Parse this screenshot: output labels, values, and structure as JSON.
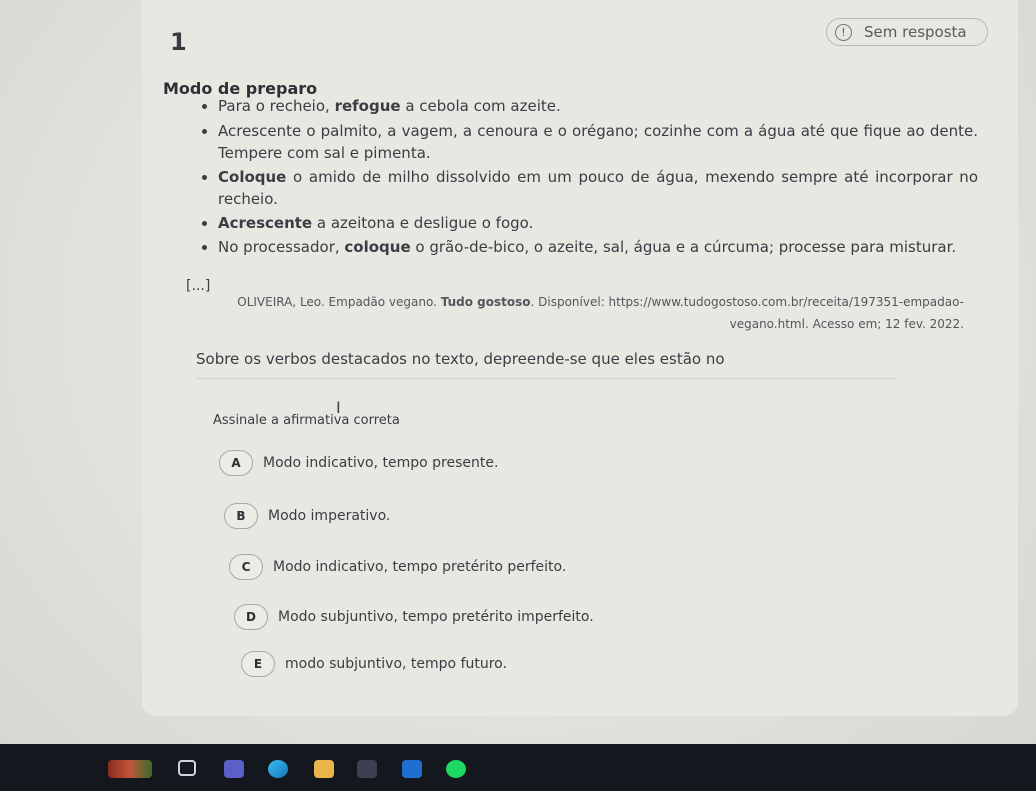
{
  "question": {
    "number": "1",
    "status": "Sem resposta"
  },
  "section": {
    "title": "Modo de preparo"
  },
  "steps": [
    {
      "plain": "Para o recheio, ",
      "bold": "refogue",
      "rest": " a cebola com azeite."
    },
    {
      "plain": "",
      "bold": "",
      "rest": "Acrescente o palmito, a vagem, a cenoura e o orégano; cozinhe com a água até que fique ao dente. Tempere com sal e pimenta."
    },
    {
      "plain": "",
      "bold": "Coloque",
      "rest": " o amido de milho dissolvido em um pouco de água, mexendo sempre até incorporar no recheio."
    },
    {
      "plain": "",
      "bold": "Acrescente",
      "rest": " a azeitona e desligue o fogo."
    },
    {
      "plain": "No processador, ",
      "bold": "coloque",
      "rest": " o grão-de-bico, o azeite, sal, água e a cúrcuma; processe para misturar."
    }
  ],
  "ellipsis": "[...]",
  "citation": {
    "before": "OLIVEIRA, Leo. Empadão vegano. ",
    "bold": "Tudo gostoso",
    "after": ". Disponível: https://www.tudogostoso.com.br/receita/197351-empadao-vegano.html. Acesso em; 12 fev. 2022."
  },
  "prompt": "Sobre os verbos destacados no texto, depreende-se que eles estão no",
  "instruction": "Assinale a afirmativa correta",
  "options": [
    {
      "letter": "A",
      "text": "Modo indicativo, tempo presente."
    },
    {
      "letter": "B",
      "text": "Modo imperativo."
    },
    {
      "letter": "C",
      "text": "Modo indicativo, tempo pretérito perfeito."
    },
    {
      "letter": "D",
      "text": "Modo subjuntivo, tempo pretérito imperfeito."
    },
    {
      "letter": "E",
      "text": "modo subjuntivo, tempo futuro."
    }
  ],
  "taskbar": {
    "icons": [
      "weather-icon",
      "taskview-icon",
      "teams-icon",
      "edge-icon",
      "file-explorer-icon",
      "store-icon",
      "outlook-icon",
      "spotify-icon"
    ]
  }
}
